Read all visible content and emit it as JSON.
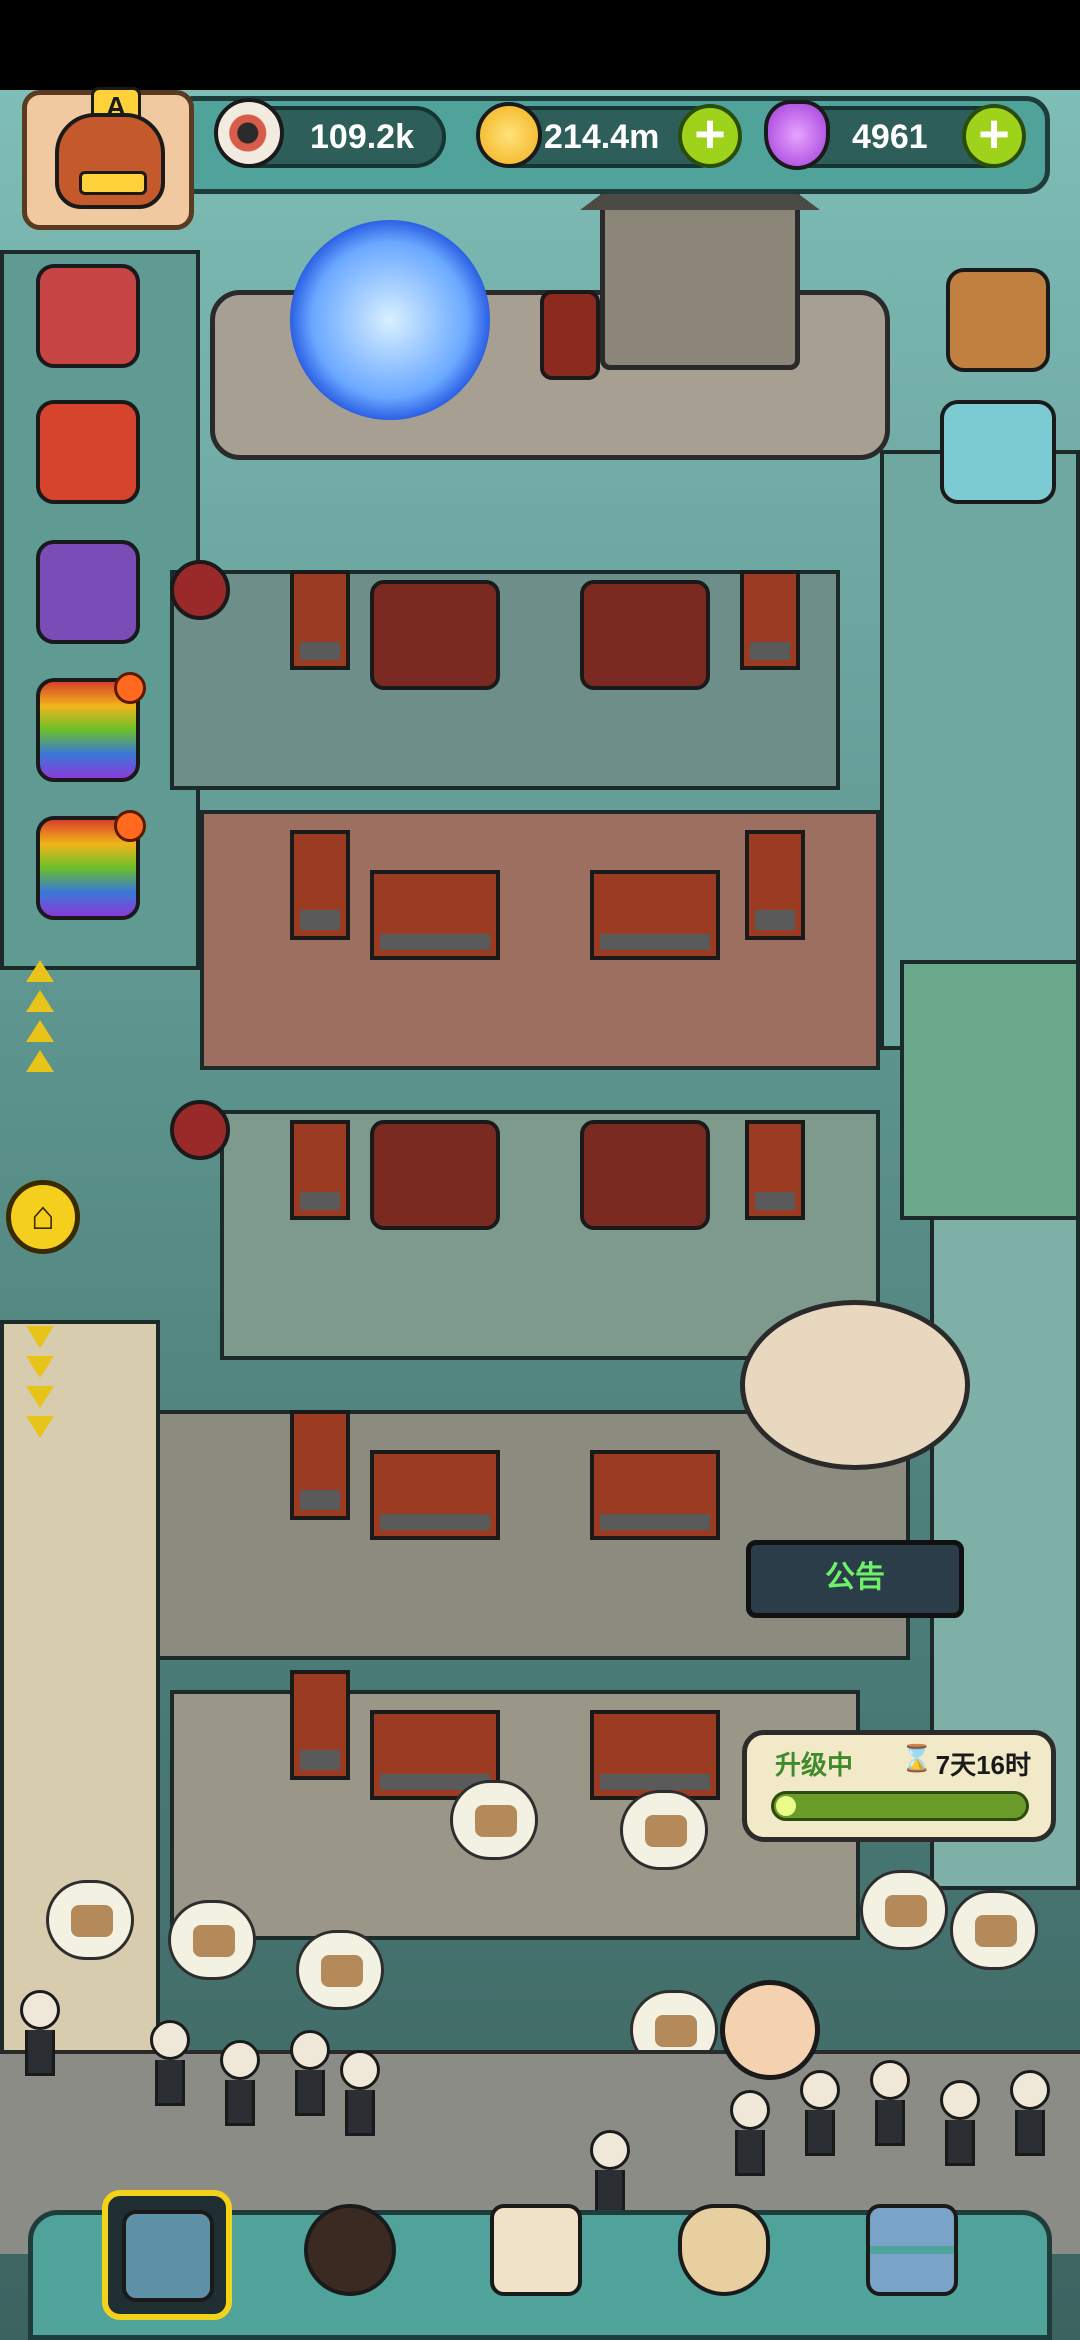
{
  "hud": {
    "eyeballs": {
      "value": "109.2k",
      "icon": "eyeball-icon"
    },
    "coins": {
      "value": "214.4m",
      "icon": "gold-coin-icon",
      "add_label": "+"
    },
    "potions": {
      "value": "4961",
      "icon": "purple-potion-icon",
      "add_label": "+"
    },
    "player_badge": "A"
  },
  "side_menu": {
    "left_items": [
      {
        "name": "gift-box-red-icon"
      },
      {
        "name": "strawberry-gift-icon"
      },
      {
        "name": "card-pack-icon"
      },
      {
        "name": "rainbow-gift-icon-1",
        "has_notification": true
      },
      {
        "name": "rainbow-gift-icon-2",
        "has_notification": true
      }
    ],
    "right_items": [
      {
        "name": "backpack-icon"
      },
      {
        "name": "monster-eggs-icon"
      }
    ],
    "home_icon": "⌂"
  },
  "building": {
    "notice_sign": "公告"
  },
  "upgrade": {
    "status_label": "升级中",
    "hourglass_icon": "⌛",
    "time_remaining": "7天16时",
    "progress": 0.06
  },
  "bottom_nav": {
    "items": [
      {
        "name": "building-tab",
        "icon": "shop-front-icon",
        "active": true
      },
      {
        "name": "monster-tab",
        "icon": "fire-monster-icon",
        "active": false
      },
      {
        "name": "book-tab",
        "icon": "open-book-icon",
        "active": false
      },
      {
        "name": "money-bag-tab",
        "icon": "money-bag-icon",
        "active": false
      },
      {
        "name": "grid-menu-tab",
        "icon": "grid-icon",
        "active": false
      }
    ]
  },
  "colors": {
    "hud_teal": "#4fa39a",
    "progress_green": "#6b9c2a",
    "notice_text": "#6ff06a",
    "highlight_yellow": "#f2d21a"
  }
}
